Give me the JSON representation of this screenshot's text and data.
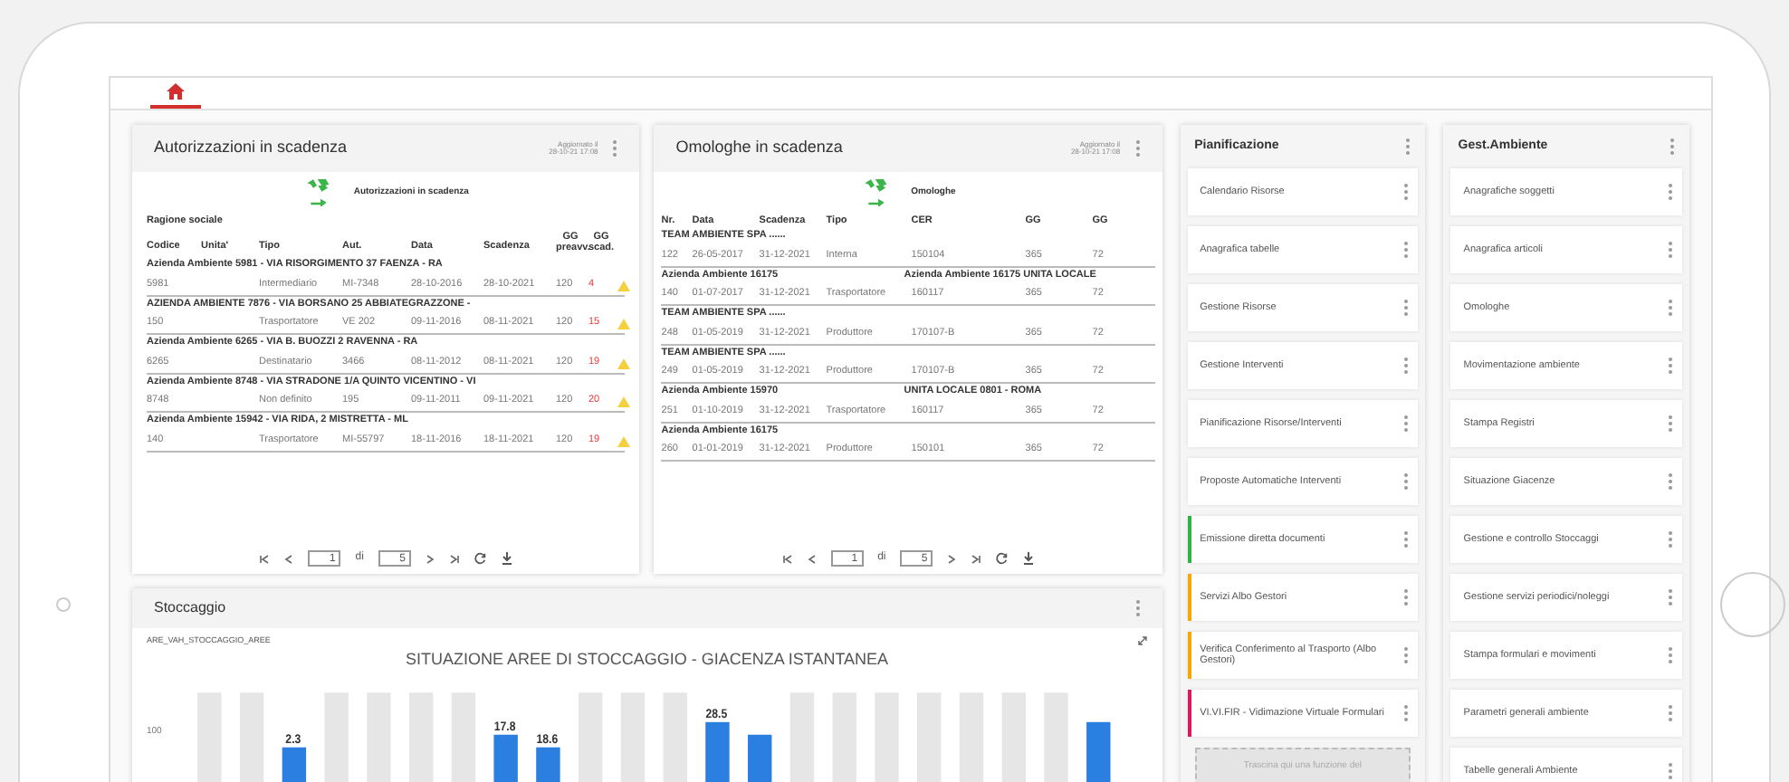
{
  "home_tab": {
    "selected": true
  },
  "authorizations": {
    "title": "Autorizzazioni in scadenza",
    "updated": "Aggiornato il",
    "updated_time": "28-10-21 17:08",
    "subtitle": "Autorizzazioni in scadenza",
    "group_label": "Ragione sociale",
    "columns": [
      "Codice",
      "Unita'",
      "Tipo",
      "Aut.",
      "Data",
      "Scadenza",
      "GG preavv.",
      "GG scad."
    ],
    "groups": [
      {
        "name": "Azienda Ambiente 5981 - VIA RISORGIMENTO 37 FAENZA - RA",
        "row": {
          "code": "5981",
          "type": "Intermediario",
          "aut": "MI-7348",
          "date": "28-10-2016",
          "due": "28-10-2021",
          "notice": "120",
          "days": "4"
        }
      },
      {
        "name": "AZIENDA AMBIENTE 7876 - VIA BORSANO 25 ABBIATEGRAZZONE -",
        "row": {
          "code": "150",
          "type": "Trasportatore",
          "aut": "VE 202",
          "date": "09-11-2016",
          "due": "08-11-2021",
          "notice": "120",
          "days": "15"
        }
      },
      {
        "name": "Azienda Ambiente 6265 - VIA B. BUOZZI 2 RAVENNA - RA",
        "row": {
          "code": "6265",
          "type": "Destinatario",
          "aut": "3466",
          "date": "08-11-2012",
          "due": "08-11-2021",
          "notice": "120",
          "days": "19"
        }
      },
      {
        "name": "Azienda Ambiente 8748 - VIA STRADONE 1/A QUINTO VICENTINO - VI",
        "row": {
          "code": "8748",
          "type": "Non definito",
          "aut": "195",
          "date": "09-11-2011",
          "due": "09-11-2021",
          "notice": "120",
          "days": "20"
        }
      },
      {
        "name": "Azienda Ambiente 15942 - VIA RIDA, 2 MISTRETTA - ML",
        "row": {
          "code": "140",
          "type": "Trasportatore",
          "aut": "MI-55797",
          "date": "18-11-2016",
          "due": "18-11-2021",
          "notice": "120",
          "days": "19"
        }
      }
    ],
    "pager": {
      "page": "1",
      "of": "di",
      "total": "5"
    }
  },
  "omologhe": {
    "title": "Omologhe in scadenza",
    "updated": "Aggiornato il",
    "updated_time": "28-10-21 17:08",
    "subtitle": "Omologhe",
    "columns": [
      "Nr.",
      "Data",
      "Scadenza",
      "Tipo",
      "CER",
      "GG",
      "GG"
    ],
    "groups": [
      {
        "name": "TEAM AMBIENTE SPA ......",
        "row": [
          "122",
          "26-05-2017",
          "31-12-2021",
          "Interna",
          "150104",
          "365",
          "72"
        ]
      },
      {
        "name": "Azienda Ambiente 16175",
        "unit": "Azienda Ambiente 16175 UNITA LOCALE",
        "row": [
          "140",
          "01-07-2017",
          "31-12-2021",
          "Trasportatore",
          "160117",
          "365",
          "72"
        ]
      },
      {
        "name": "TEAM AMBIENTE SPA ......",
        "row": [
          "248",
          "01-05-2019",
          "31-12-2021",
          "Produttore",
          "170107-B",
          "365",
          "72"
        ]
      },
      {
        "name": "TEAM AMBIENTE SPA ......",
        "row": [
          "249",
          "01-05-2019",
          "31-12-2021",
          "Produttore",
          "170107-B",
          "365",
          "72"
        ]
      },
      {
        "name": "Azienda Ambiente 15970",
        "unit": "UNITA LOCALE 0801 - ROMA",
        "row": [
          "251",
          "01-10-2019",
          "31-12-2021",
          "Trasportatore",
          "160117",
          "365",
          "72"
        ]
      },
      {
        "name": "Azienda Ambiente 16175",
        "row": [
          "260",
          "01-01-2019",
          "31-12-2021",
          "Produttore",
          "150101",
          "365",
          "72"
        ]
      }
    ],
    "pager": {
      "page": "1",
      "of": "di",
      "total": "5"
    }
  },
  "storage": {
    "title": "Stoccaggio",
    "source": "ARE_VAH_STOCCAGGIO_AREE",
    "chart_title": "SITUAZIONE AREE DI STOCCAGGIO - GIACENZA ISTANTANEA",
    "y_tick": "100",
    "bar_labels": [
      "2.3",
      "17.8",
      "18.6",
      "28.5"
    ]
  },
  "planning": {
    "title": "Pianificazione",
    "items": [
      {
        "label": "Calendario Risorse",
        "kind": "item"
      },
      {
        "label": "Anagrafica tabelle",
        "kind": "item"
      },
      {
        "label": "Gestione Risorse",
        "kind": "item"
      },
      {
        "label": "Gestione Interventi",
        "kind": "item"
      },
      {
        "label": "Pianificazione Risorse/Interventi",
        "kind": "item"
      },
      {
        "label": "Proposte Automatiche Interventi",
        "kind": "item"
      },
      {
        "label": "Emissione diretta documenti",
        "kind": "item",
        "color": "#2fb344"
      },
      {
        "label": "Servizi Albo Gestori",
        "kind": "item",
        "color": "#f5a800"
      },
      {
        "label": "Verifica Conferimento al Trasporto (Albo Gestori)",
        "kind": "item",
        "color": "#f5a800"
      },
      {
        "label": "VI.VI.FIR - Vidimazione Virtuale Formulari",
        "kind": "item",
        "color": "#d81b60"
      },
      {
        "label": "Trascina qui una funzione del",
        "kind": "drop"
      }
    ]
  },
  "environment": {
    "title": "Gest.Ambiente",
    "items": [
      {
        "label": "Anagrafiche soggetti"
      },
      {
        "label": "Anagrafica articoli"
      },
      {
        "label": "Omologhe"
      },
      {
        "label": "Movimentazione ambiente"
      },
      {
        "label": "Stampa Registri"
      },
      {
        "label": "Situazione Giacenze"
      },
      {
        "label": "Gestione e controllo Stoccaggi"
      },
      {
        "label": "Gestione servizi periodici/noleggi"
      },
      {
        "label": "Stampa formulari e movimenti"
      },
      {
        "label": "Parametri generali ambiente"
      },
      {
        "label": "Tabelle generali Ambiente"
      }
    ]
  }
}
